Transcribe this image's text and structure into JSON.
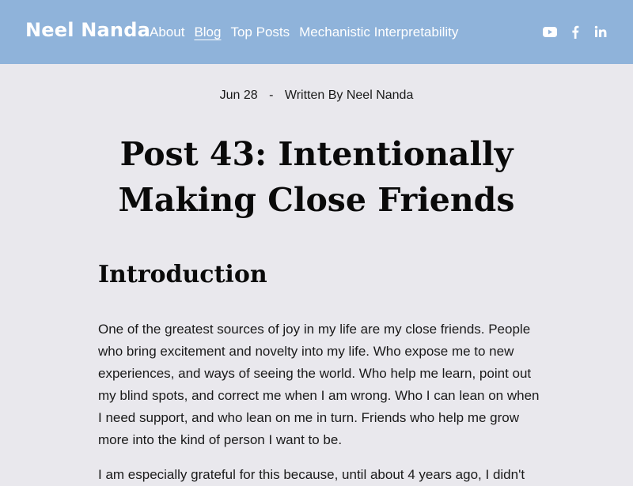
{
  "header": {
    "site_title": "Neel Nanda",
    "nav": [
      {
        "label": "About",
        "active": false
      },
      {
        "label": "Blog",
        "active": true
      },
      {
        "label": "Top Posts",
        "active": false
      },
      {
        "label": "Mechanistic Interpretability",
        "active": false
      }
    ],
    "social_icons": [
      "youtube-icon",
      "facebook-icon",
      "linkedin-icon"
    ]
  },
  "post": {
    "date": "Jun 28",
    "separator": "-",
    "author_line": "Written By Neel Nanda",
    "title": "Post 43: Intentionally Making Close Friends",
    "section_heading": "Introduction",
    "paragraph_1": "One of the greatest sources of joy in my life are my close friends. People who bring excitement and novelty into my life. Who expose me to new experiences, and ways of seeing the world. Who help me learn, point out my blind spots, and correct me when I am wrong. Who I can lean on when I need support, and who lean on me in turn. Friends who help me grow more into the kind of person I want to be.",
    "paragraph_2_partial": "I am especially grateful for this because, until about 4 years ago, I didn't"
  },
  "colors": {
    "header_bg": "#8fb3da",
    "page_bg": "#e9e8ed",
    "header_text": "#ffffff"
  }
}
